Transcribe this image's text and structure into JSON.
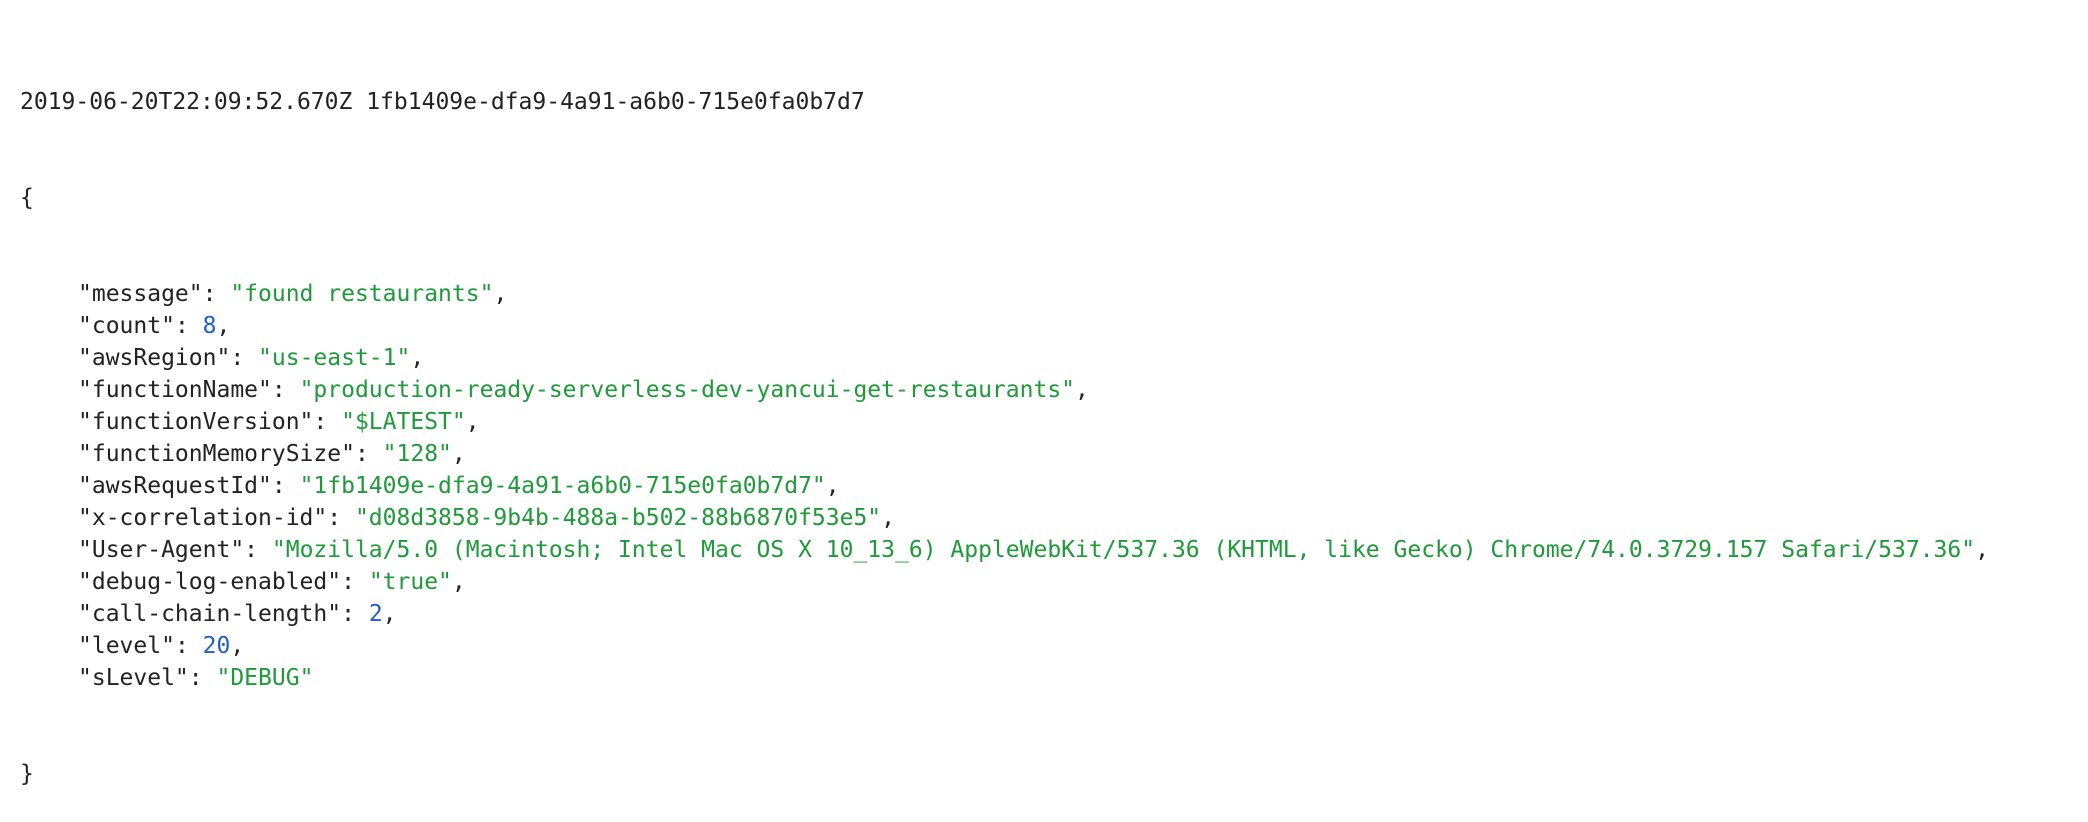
{
  "log": {
    "timestamp": "2019-06-20T22:09:52.670Z",
    "request_id": "1fb1409e-dfa9-4a91-a6b0-715e0fa0b7d7",
    "open_brace": "{",
    "close_brace": "}",
    "fields": [
      {
        "key": "\"message\"",
        "value": "\"found restaurants\"",
        "type": "string"
      },
      {
        "key": "\"count\"",
        "value": "8",
        "type": "number"
      },
      {
        "key": "\"awsRegion\"",
        "value": "\"us-east-1\"",
        "type": "string"
      },
      {
        "key": "\"functionName\"",
        "value": "\"production-ready-serverless-dev-yancui-get-restaurants\"",
        "type": "string"
      },
      {
        "key": "\"functionVersion\"",
        "value": "\"$LATEST\"",
        "type": "string"
      },
      {
        "key": "\"functionMemorySize\"",
        "value": "\"128\"",
        "type": "string"
      },
      {
        "key": "\"awsRequestId\"",
        "value": "\"1fb1409e-dfa9-4a91-a6b0-715e0fa0b7d7\"",
        "type": "string"
      },
      {
        "key": "\"x-correlation-id\"",
        "value": "\"d08d3858-9b4b-488a-b502-88b6870f53e5\"",
        "type": "string"
      },
      {
        "key": "\"User-Agent\"",
        "value": "\"Mozilla/5.0 (Macintosh; Intel Mac OS X 10_13_6) AppleWebKit/537.36 (KHTML, like Gecko) Chrome/74.0.3729.157 Safari/537.36\"",
        "type": "string"
      },
      {
        "key": "\"debug-log-enabled\"",
        "value": "\"true\"",
        "type": "string"
      },
      {
        "key": "\"call-chain-length\"",
        "value": "2",
        "type": "number"
      },
      {
        "key": "\"level\"",
        "value": "20",
        "type": "number"
      },
      {
        "key": "\"sLevel\"",
        "value": "\"DEBUG\"",
        "type": "string"
      }
    ]
  },
  "colors": {
    "string": "#1f9a3a",
    "number": "#2160c4",
    "text": "#222222"
  }
}
